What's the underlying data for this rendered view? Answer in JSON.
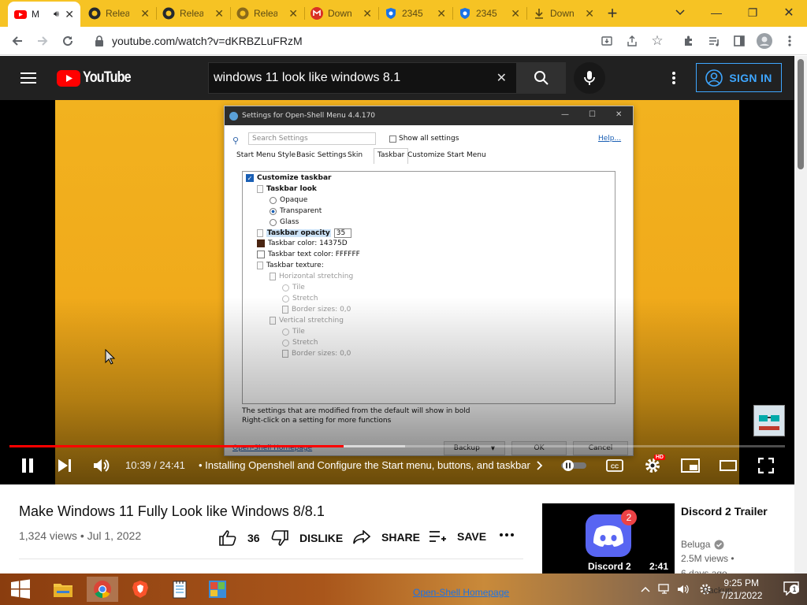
{
  "browser": {
    "tabs": [
      {
        "title": "M",
        "active": true,
        "icon": "youtube-icon",
        "audio": true
      },
      {
        "title": "Relea",
        "icon": "github-icon"
      },
      {
        "title": "Relea",
        "icon": "github-icon"
      },
      {
        "title": "Relea",
        "icon": "github-icon"
      },
      {
        "title": "Down",
        "icon": "gmail-icon"
      },
      {
        "title": "2345",
        "icon": "shield-icon"
      },
      {
        "title": "2345",
        "icon": "shield-icon"
      },
      {
        "title": "Down",
        "icon": "download-icon"
      }
    ],
    "url": "youtube.com/watch?v=dKRBZLuFRzM"
  },
  "youtube": {
    "logo_text": "YouTube",
    "search_query": "windows 11 look like windows 8.1",
    "sign_in": "SIGN IN"
  },
  "dialog": {
    "title": "Settings for Open-Shell Menu 4.4.170",
    "search_placeholder": "Search Settings",
    "show_all": "Show all settings",
    "help": "Help...",
    "tabs": [
      "Start Menu Style",
      "Basic Settings",
      "Skin",
      "Taskbar",
      "Customize Start Menu"
    ],
    "tree": {
      "customize_taskbar": "Customize taskbar",
      "taskbar_look": "Taskbar look",
      "opaque": "Opaque",
      "transparent": "Transparent",
      "glass": "Glass",
      "opacity_label": "Taskbar opacity",
      "opacity_value": "35",
      "color": "Taskbar color: 14375D",
      "text_color": "Taskbar text color: FFFFFF",
      "texture": "Taskbar texture:",
      "hstretch": "Horizontal stretching",
      "tile1": "Tile",
      "stretch1": "Stretch",
      "border1": "Border sizes: 0,0",
      "vstretch": "Vertical stretching",
      "tile2": "Tile",
      "stretch2": "Stretch",
      "border2": "Border sizes: 0,0"
    },
    "note1": "The settings that are modified from the default will show in bold",
    "note2": "Right-click on a setting for more functions",
    "homepage": "Open-Shell Homepage",
    "backup": "Backup",
    "ok": "OK",
    "cancel": "Cancel"
  },
  "player": {
    "time": "10:39 / 24:41",
    "chapter": "• Installing Openshell and Configure the Start menu, buttons, and taskbar",
    "progress_fraction": 0.431,
    "buffered_fraction": 0.51,
    "hd_badge": "HD"
  },
  "video": {
    "title": "Make Windows 11 Fully Look like Windows 8/8.1",
    "meta": "1,324 views • Jul 1, 2022",
    "likes": "36",
    "dislike": "DISLIKE",
    "share": "SHARE",
    "save": "SAVE"
  },
  "recommended": {
    "title": "Discord 2 Trailer",
    "channel": "Beluga",
    "views": "2.5M views •",
    "age": "6 days ago",
    "thumb_caption": "Discord 2",
    "badge": "2",
    "duration": "2:41"
  },
  "taskbar": {
    "link": "Open-Shell Homepage",
    "time": "9:25 PM",
    "date": "7/21/2022",
    "notifications": "1",
    "backup_overlay": "Backup"
  },
  "colors": {
    "tabbar": "#f6c324",
    "yt_red": "#ff0000",
    "yt_dark": "#212121",
    "signin_blue": "#3ea6ff"
  }
}
